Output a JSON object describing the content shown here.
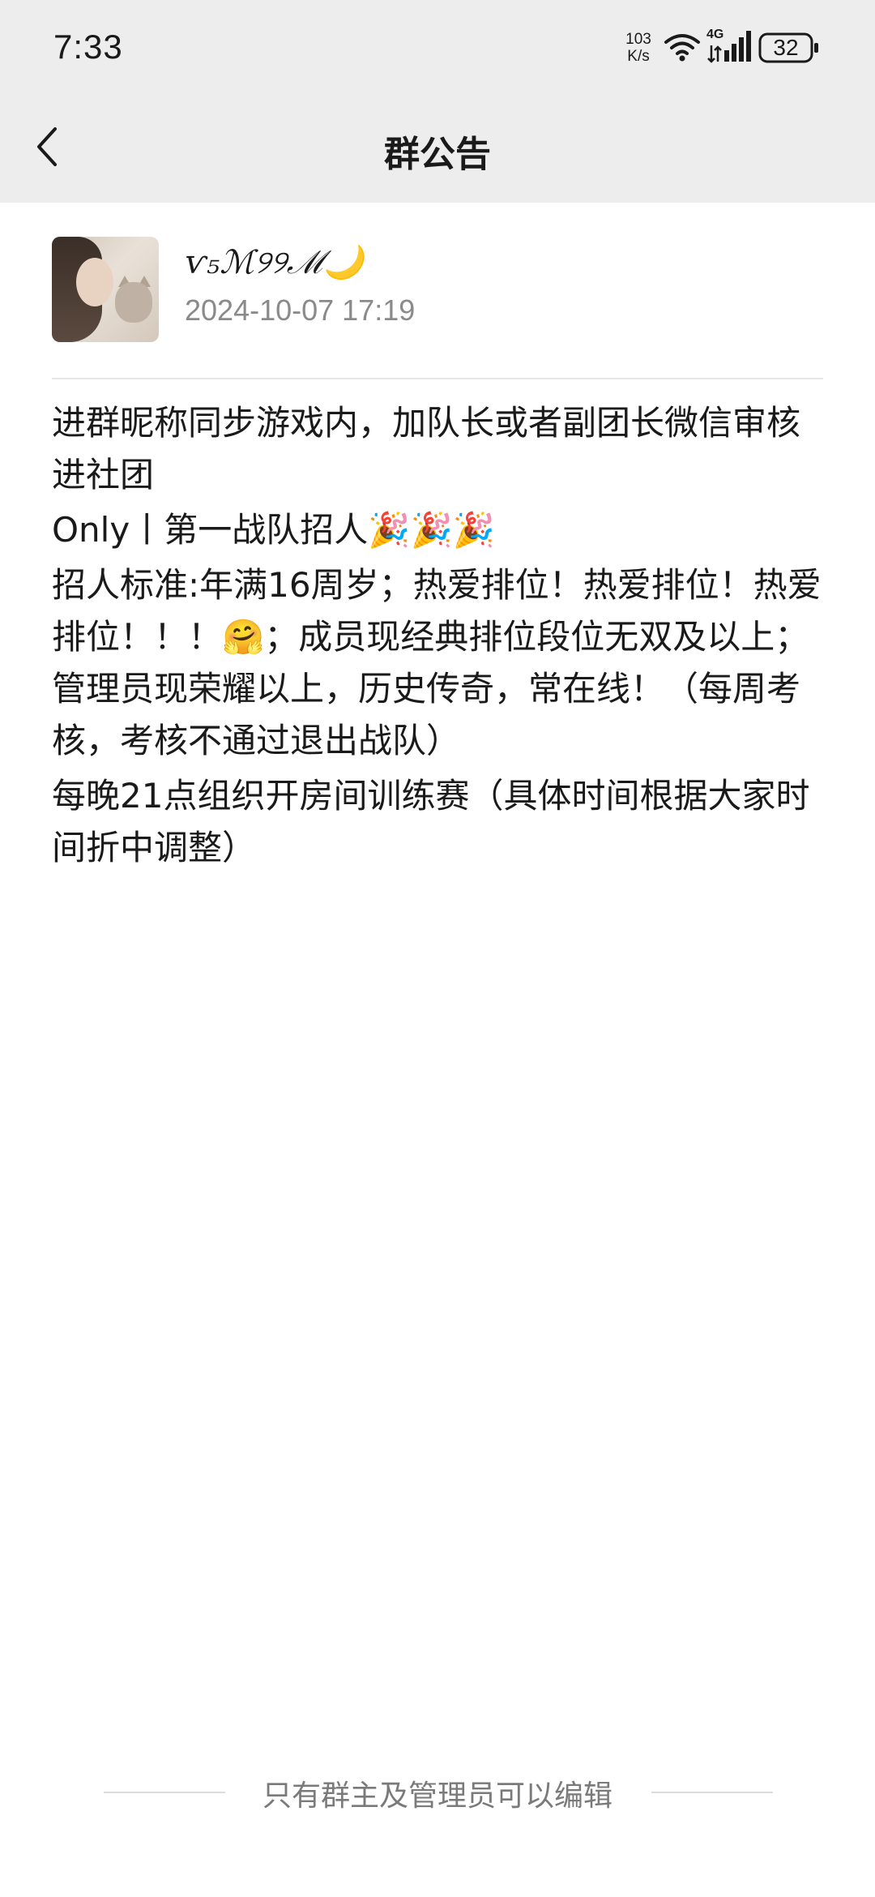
{
  "status_bar": {
    "time": "7:33",
    "net_speed_value": "103",
    "net_speed_unit": "K/s",
    "network_type": "4G",
    "battery": "32",
    "icons": [
      "wifi-icon",
      "signal-icon",
      "battery-icon"
    ]
  },
  "nav": {
    "back_icon": "chevron-left-icon",
    "title": "群公告"
  },
  "author": {
    "name": "ѵ₅ℳ୨୨ℳ🌙",
    "timestamp": "2024-10-07 17:19"
  },
  "announcement": {
    "paragraphs": [
      "进群昵称同步游戏内，加队长或者副团长微信审核进社团",
      "Only丨第一战队招人🎉🎉🎉",
      "招人标准:年满16周岁；热爱排位！热爱排位！热爱排位！！！🤗；成员现经典排位段位无双及以上；管理员现荣耀以上，历史传奇，常在线！（每周考核，考核不通过退出战队）",
      "每晚21点组织开房间训练赛（具体时间根据大家时间折中调整）"
    ]
  },
  "footer": {
    "note": "只有群主及管理员可以编辑"
  },
  "colors": {
    "header_bg": "#ededed",
    "text_primary": "#1a1a1a",
    "text_secondary": "#8a8a8a",
    "divider": "#e6e6e6"
  }
}
